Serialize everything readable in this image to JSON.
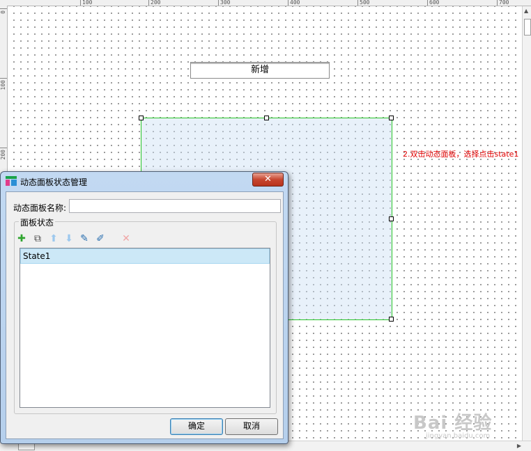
{
  "ruler": {
    "top_ticks": [
      "100",
      "200",
      "300",
      "400",
      "500",
      "600",
      "700"
    ],
    "left_ticks": [
      "0",
      "100",
      "200"
    ]
  },
  "canvas": {
    "add_button_label": "新增",
    "annotation": "2.双击动态面板，选择点击state1",
    "panel_border_color": "#27c427",
    "annotation_color": "#e00000"
  },
  "dialog": {
    "title": "动态面板状态管理",
    "close_label": "✕",
    "name_label": "动态面板名称:",
    "name_value": "",
    "states_group_label": "面板状态",
    "toolbar": [
      {
        "icon": "plus-icon",
        "glyph": "✚"
      },
      {
        "icon": "duplicate-icon",
        "glyph": "⧉"
      },
      {
        "icon": "move-up-icon",
        "glyph": "⬆"
      },
      {
        "icon": "move-down-icon",
        "glyph": "⬇"
      },
      {
        "icon": "edit-state-icon",
        "glyph": "✎"
      },
      {
        "icon": "edit-all-icon",
        "glyph": "✐"
      },
      {
        "icon": "delete-icon",
        "glyph": "✕"
      }
    ],
    "states": [
      "State1"
    ],
    "ok_label": "确定",
    "cancel_label": "取消"
  },
  "watermark": {
    "main": "Bai 经验",
    "sub": "jingyan.baidu.com"
  }
}
